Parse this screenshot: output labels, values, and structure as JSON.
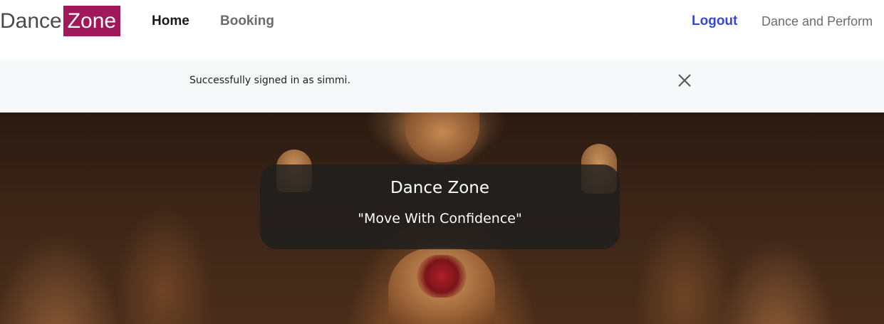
{
  "navbar": {
    "brand_part1": "Dance",
    "brand_part2": "Zone",
    "brand_color": "#a0185a",
    "links": [
      {
        "label": "Home",
        "active": true
      },
      {
        "label": "Booking"
      }
    ],
    "right_links": [
      {
        "label": "Logout",
        "color": "#3b46d6"
      },
      {
        "label": "Dance and Perform"
      }
    ]
  },
  "alert": {
    "message": "Successfully signed in as simmi.",
    "close_icon": "close-icon"
  },
  "hero": {
    "title": "Dance Zone",
    "tagline": "\"Move With Confidence\""
  }
}
